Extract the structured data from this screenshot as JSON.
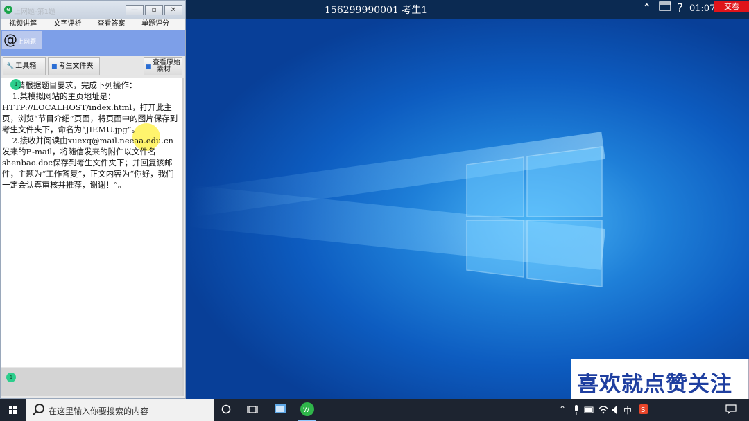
{
  "window": {
    "title": "上网题-第1题",
    "menu": [
      "视频讲解(D)",
      "文字评析(Y)",
      "查看答案(A)",
      "单题评分(P)"
    ],
    "logo_text": "上网题",
    "toolbar": {
      "toolbox": "工具箱",
      "student_folder": "考生文件夹",
      "view_source_line1": "查看原始",
      "view_source_line2": "素材"
    },
    "question_number": "1",
    "answer_number": "1",
    "question_text": "      请根据题目要求，完成下列操作：\n    1.某模拟网站的主页地址是：\nHTTP://LOCALHOST/index.html，打开此主页，浏览“节目介绍”页面，将页面中的图片保存到考生文件夹下，命名为“JIEMU.jpg”。\n    2.接收并阅读由xuexq@mail.neeaa.edu.cn发来的E-mail，将随信发来的附件以文件名shenbao.doc保存到考生文件夹下；并回复该邮件，主题为“工作答复”，正文内容为“你好，我们一定会认真审核并推荐，谢谢！”。"
  },
  "topbar": {
    "exam_info": "156299990001  考生1",
    "time": "01:07",
    "submit_label": "交卷"
  },
  "banner": {
    "text": "喜欢就点赞关注"
  },
  "taskbar": {
    "search_placeholder": "在这里输入你要搜索的内容",
    "ime": "中"
  },
  "colors": {
    "desktop": "#0d5cc0",
    "submit": "#e0141a",
    "taskbar": "#1d2430",
    "banner_text": "#1f3fa0"
  }
}
